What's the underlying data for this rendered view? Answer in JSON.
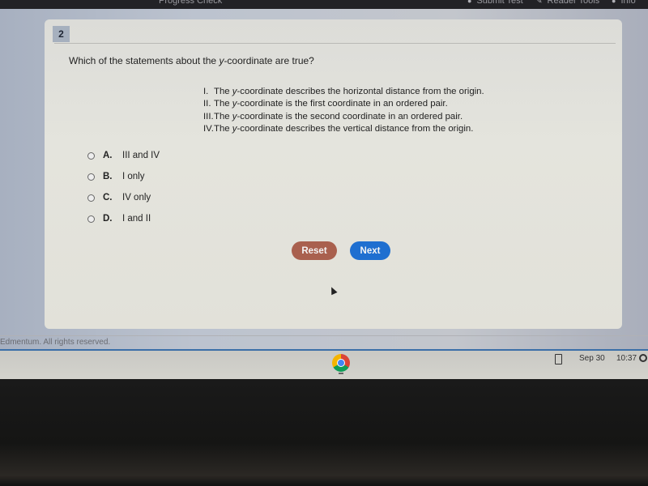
{
  "topbar": {
    "title": "Progress Check",
    "tools": [
      {
        "label": "Submit Test",
        "icon": "check-icon"
      },
      {
        "label": "Reader Tools",
        "icon": "pen-icon"
      },
      {
        "label": "Info",
        "icon": "info-icon"
      }
    ]
  },
  "question": {
    "number": "2",
    "prompt_before": "Which of the statements about the ",
    "prompt_italic": "y",
    "prompt_after": "-coordinate are true?",
    "statements": [
      {
        "num": "I.",
        "before": "The ",
        "italic": "y",
        "after": "-coordinate describes the horizontal distance from the origin."
      },
      {
        "num": "II.",
        "before": "The ",
        "italic": "y",
        "after": "-coordinate is the first coordinate in an ordered pair."
      },
      {
        "num": "III.",
        "before": "The ",
        "italic": "y",
        "after": "-coordinate is the second coordinate in an ordered pair."
      },
      {
        "num": "IV.",
        "before": "The ",
        "italic": "y",
        "after": "-coordinate describes the vertical distance from the origin."
      }
    ],
    "choices": [
      {
        "letter": "A.",
        "text": "III and IV",
        "selected": false
      },
      {
        "letter": "B.",
        "text": "I only",
        "selected": false
      },
      {
        "letter": "C.",
        "text": "IV only",
        "selected": false
      },
      {
        "letter": "D.",
        "text": "I and II",
        "selected": false
      }
    ]
  },
  "buttons": {
    "reset": "Reset",
    "next": "Next",
    "reset_color": "#a9604e",
    "next_color": "#1f6fd0"
  },
  "footer": {
    "copyright": "Edmentum. All rights reserved."
  },
  "shelf": {
    "app": "chrome-icon",
    "date": "Sep 30",
    "time": "10:37"
  }
}
